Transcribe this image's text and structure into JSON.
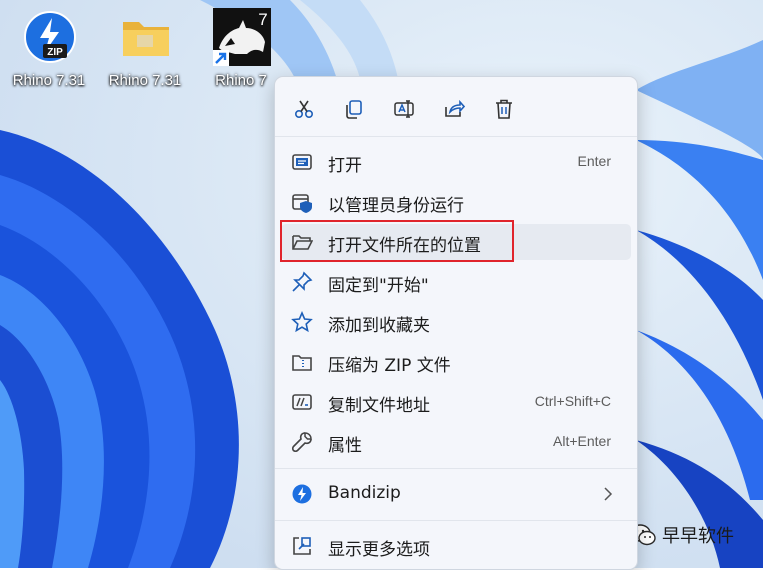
{
  "desktop": {
    "icons": [
      {
        "label": "Rhino 7.31",
        "icon": "zip-archive-icon"
      },
      {
        "label": "Rhino 7.31",
        "icon": "folder-icon"
      },
      {
        "label": "Rhino 7",
        "icon": "rhino-app-shortcut-icon",
        "badge": "7"
      }
    ]
  },
  "context_menu": {
    "quick_actions": [
      {
        "icon": "cut-icon"
      },
      {
        "icon": "copy-icon"
      },
      {
        "icon": "rename-icon"
      },
      {
        "icon": "share-icon"
      },
      {
        "icon": "delete-icon"
      }
    ],
    "items": [
      {
        "label": "打开",
        "shortcut": "Enter",
        "icon": "open-window-icon"
      },
      {
        "label": "以管理员身份运行",
        "icon": "admin-shield-icon"
      },
      {
        "label": "打开文件所在的位置",
        "icon": "folder-open-icon"
      },
      {
        "label": "固定到\"开始\"",
        "icon": "pin-icon"
      },
      {
        "label": "添加到收藏夹",
        "icon": "star-icon"
      },
      {
        "label": "压缩为 ZIP 文件",
        "icon": "zip-folder-icon"
      },
      {
        "label": "复制文件地址",
        "shortcut": "Ctrl+Shift+C",
        "icon": "copy-path-icon"
      },
      {
        "label": "属性",
        "shortcut": "Alt+Enter",
        "icon": "wrench-icon"
      },
      {
        "label": "Bandizip",
        "icon": "bandizip-icon",
        "submenu": true
      },
      {
        "label": "显示更多选项",
        "icon": "more-options-icon"
      }
    ]
  },
  "annotation": {
    "highlight_color": "#e0242c"
  },
  "watermark": {
    "text": "早早软件",
    "icon": "wechat-icon"
  }
}
